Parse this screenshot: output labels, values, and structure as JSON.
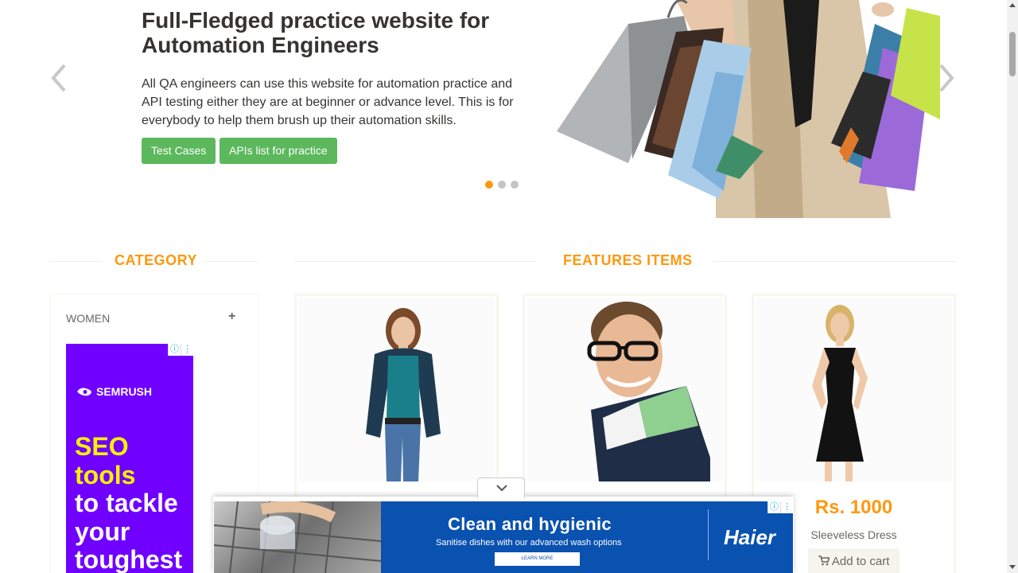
{
  "hero": {
    "title": "Full-Fledged practice website for Automation Engineers",
    "description": "All QA engineers can use this website for automation practice and API testing either they are at beginner or advance level. This is for everybody to help them brush up their automation skills.",
    "buttons": {
      "test_cases": "Test Cases",
      "apis_list": "APIs list for practice"
    },
    "slide_count": 3,
    "active_slide": 1
  },
  "sections": {
    "category": "CATEGORY",
    "features": "FEATURES ITEMS"
  },
  "category": {
    "items": [
      {
        "label": "WOMEN",
        "toggle": "+"
      }
    ]
  },
  "side_ad": {
    "brand": "SEMRUSH",
    "headline_yellow_1": "SEO",
    "headline_yellow_2": "tools",
    "headline_white_1": "to tackle",
    "headline_white_2": "your",
    "headline_white_3": "toughest"
  },
  "products": [
    {
      "price": "",
      "name": "",
      "cart_label": ""
    },
    {
      "price": "",
      "name": "",
      "cart_label": ""
    },
    {
      "price": "Rs. 1000",
      "name": "Sleeveless Dress",
      "cart_label": "Add to cart"
    }
  ],
  "bottom_ad": {
    "headline": "Clean and hygienic",
    "subtext": "Sanitise dishes with our advanced wash options",
    "cta": "LEARN MORE",
    "brand": "Haier"
  },
  "colors": {
    "accent": "#fe980f",
    "button_green": "#5cb85c",
    "semrush_purple": "#7000ff",
    "semrush_yellow": "#fff200",
    "haier_blue": "#0a52b0"
  },
  "icons": {
    "ad_info": "ⓘ",
    "ad_menu": "⋮"
  }
}
